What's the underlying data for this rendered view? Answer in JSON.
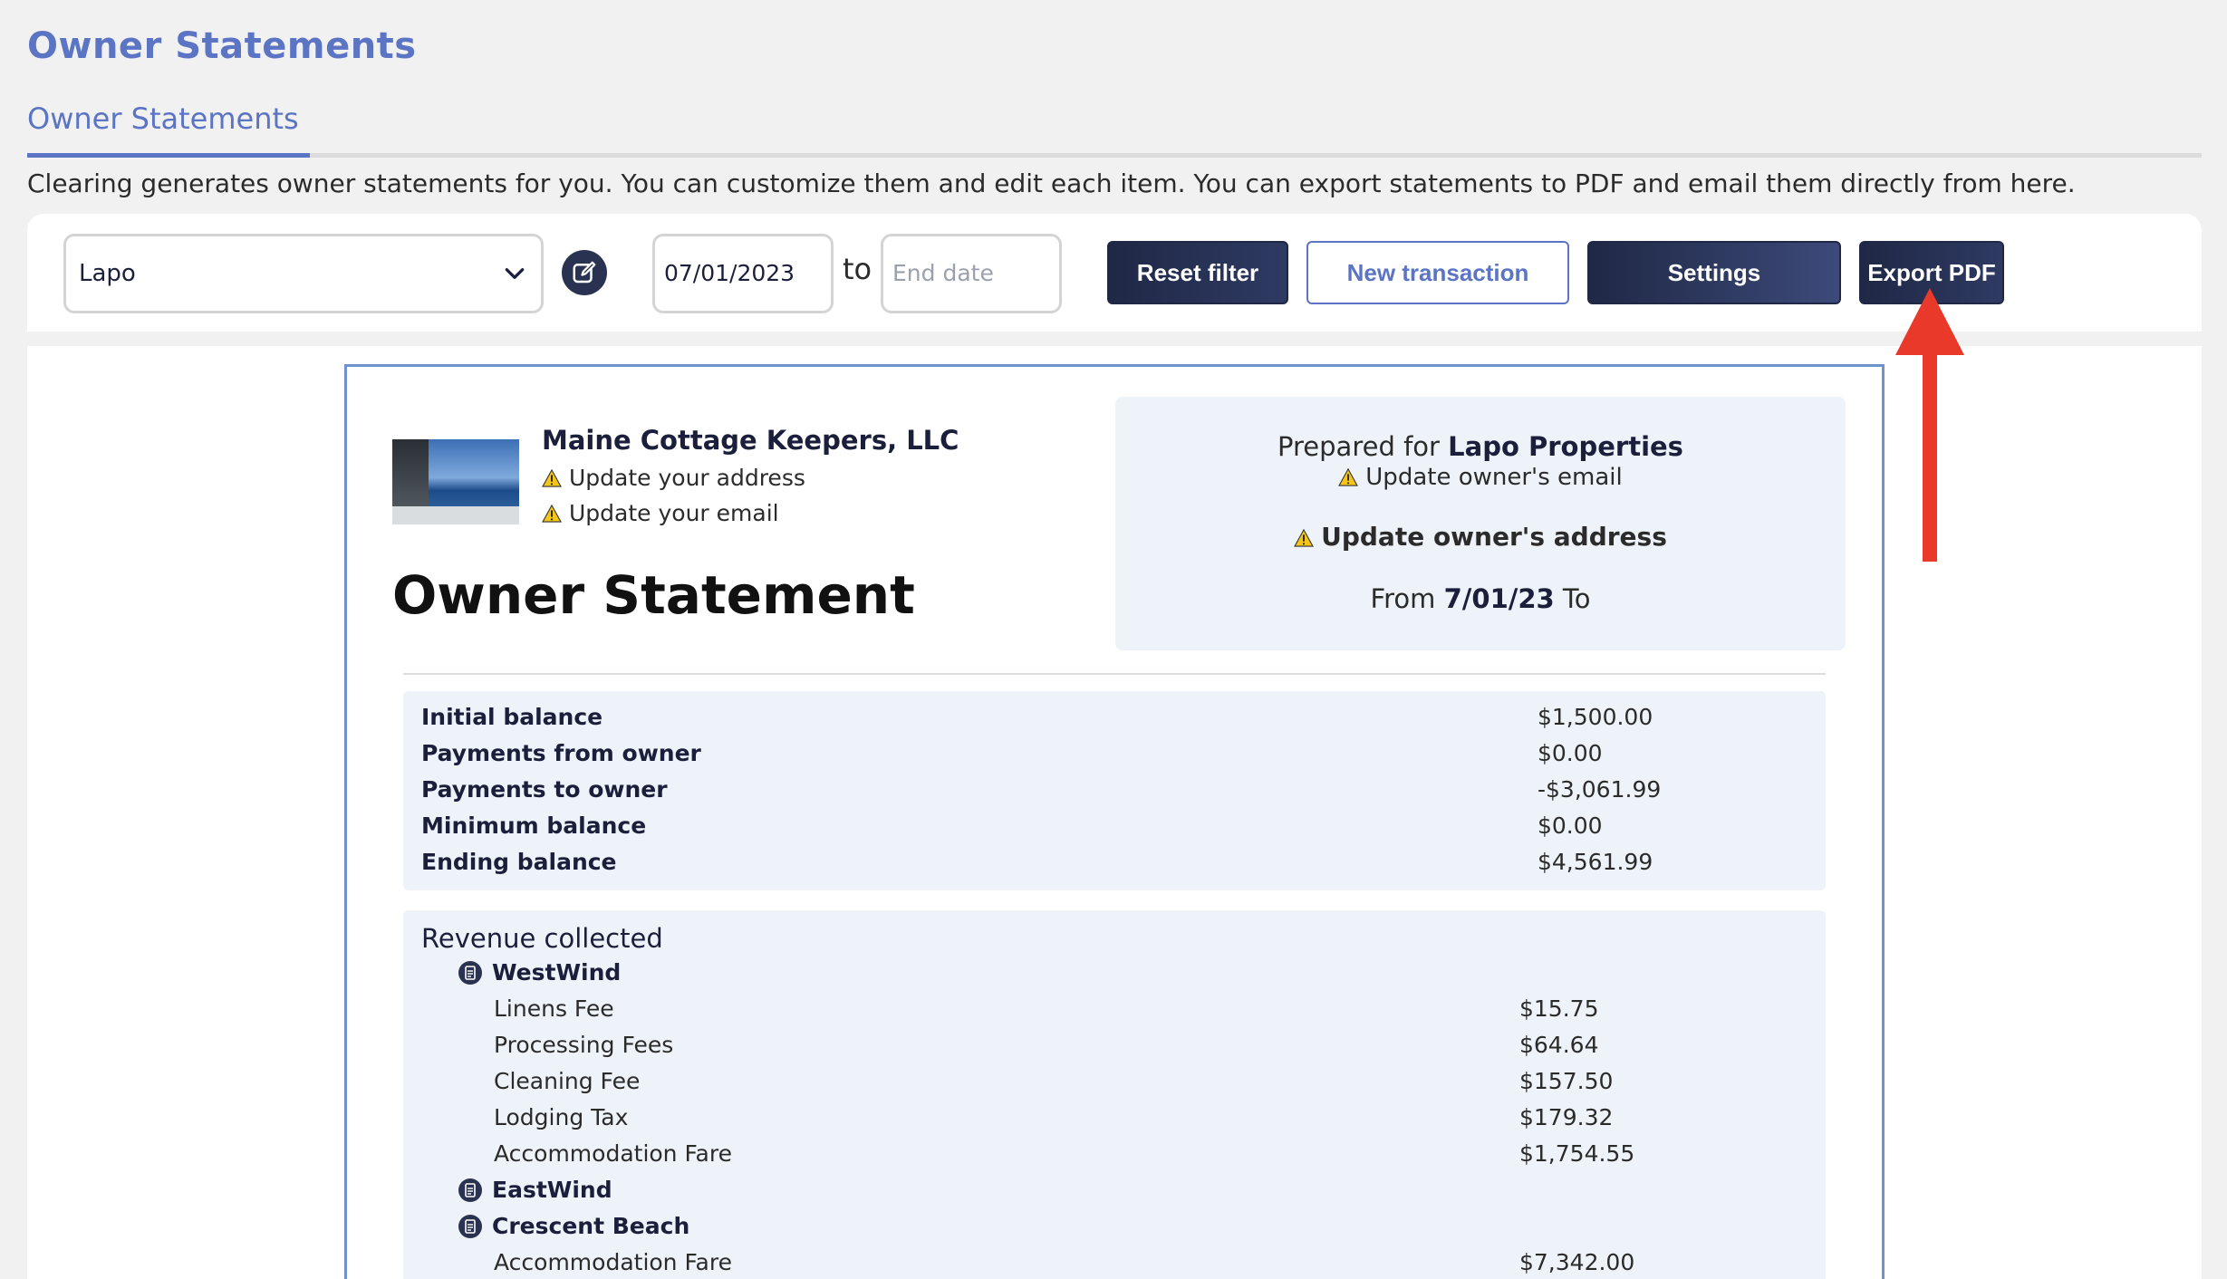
{
  "page": {
    "title": "Owner Statements",
    "tab_label": "Owner Statements",
    "description": "Clearing generates owner statements for you. You can customize them and edit each item. You can export statements to PDF and email them directly from here."
  },
  "toolbar": {
    "owner_select_value": "Lapo",
    "start_date_value": "07/01/2023",
    "to_label": "to",
    "end_date_placeholder": "End date",
    "reset_label": "Reset filter",
    "new_transaction_label": "New transaction",
    "settings_label": "Settings",
    "export_label": "Export PDF"
  },
  "statement": {
    "company_name": "Maine Cottage Keepers, LLC",
    "update_address": "Update your address",
    "update_email": "Update your email",
    "doc_title": "Owner Statement",
    "prepared_for_prefix": "Prepared for",
    "prepared_for_name": "Lapo Properties",
    "update_owner_email": "Update owner's email",
    "update_owner_address": "Update owner's address",
    "from_label": "From",
    "from_date": "7/01/23",
    "to_label": "To"
  },
  "summary": [
    {
      "label": "Initial balance",
      "value": "$1,500.00"
    },
    {
      "label": "Payments from owner",
      "value": "$0.00"
    },
    {
      "label": "Payments to owner",
      "value": "-$3,061.99"
    },
    {
      "label": "Minimum balance",
      "value": "$0.00"
    },
    {
      "label": "Ending balance",
      "value": "$4,561.99"
    }
  ],
  "revenue": {
    "title": "Revenue collected",
    "properties": [
      {
        "name": "WestWind"
      },
      {
        "name": "EastWind"
      },
      {
        "name": "Crescent Beach"
      }
    ],
    "westwind_items": [
      {
        "label": "Linens Fee",
        "value": "$15.75"
      },
      {
        "label": "Processing Fees",
        "value": "$64.64"
      },
      {
        "label": "Cleaning Fee",
        "value": "$157.50"
      },
      {
        "label": "Lodging Tax",
        "value": "$179.32"
      },
      {
        "label": "Accommodation Fare",
        "value": "$1,754.55"
      }
    ],
    "crescent_items": [
      {
        "label": "Accommodation Fare",
        "value": "$7,342.00"
      }
    ]
  },
  "colors": {
    "accent": "#5b74c4",
    "dark_button": "#1f2845",
    "arrow": "#e8392a"
  }
}
